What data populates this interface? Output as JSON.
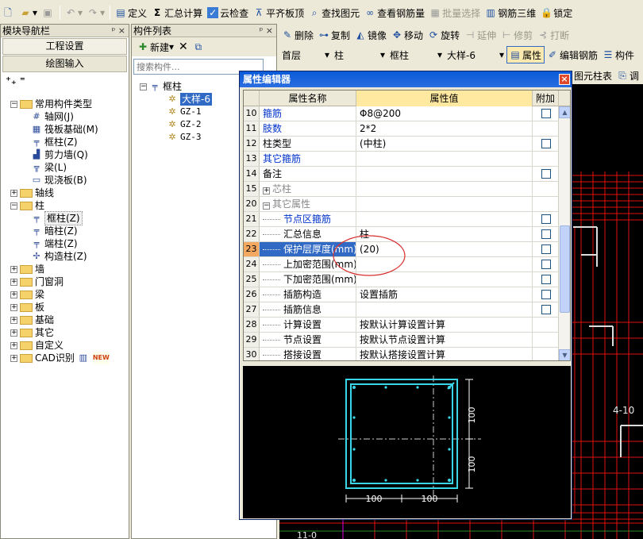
{
  "toolbar1": {
    "items": [
      {
        "label": "定义",
        "icon": "define-icon"
      },
      {
        "label": "汇总计算",
        "icon": "sigma-icon"
      },
      {
        "label": "云检查",
        "icon": "cloud-check-icon"
      },
      {
        "label": "平齐板顶",
        "icon": "align-slab-icon"
      },
      {
        "label": "查找图元",
        "icon": "find-icon"
      },
      {
        "label": "查看钢筋量",
        "icon": "view-rebar-icon"
      },
      {
        "label": "批量选择",
        "icon": "batch-select-icon"
      },
      {
        "label": "钢筋三维",
        "icon": "rebar-3d-icon"
      },
      {
        "label": "锁定",
        "icon": "lock-icon"
      }
    ]
  },
  "toolbar2": {
    "items": [
      {
        "label": "删除",
        "icon": "delete-icon"
      },
      {
        "label": "复制",
        "icon": "copy-icon"
      },
      {
        "label": "镜像",
        "icon": "mirror-icon"
      },
      {
        "label": "移动",
        "icon": "move-icon"
      },
      {
        "label": "旋转",
        "icon": "rotate-icon"
      },
      {
        "label": "延伸",
        "icon": "extend-icon"
      },
      {
        "label": "修剪",
        "icon": "trim-icon"
      },
      {
        "label": "打断",
        "icon": "break-icon"
      }
    ]
  },
  "toolbar3": {
    "floor": "首层",
    "type": "柱",
    "subtype": "框柱",
    "component": "大样-6",
    "properties": "属性",
    "edit_rebar": "编辑钢筋",
    "component_list": "构件",
    "table_tab": "图元柱表",
    "adjust": "调"
  },
  "nav_panel": {
    "title": "模块导航栏",
    "pin": "ᵖ",
    "close": "×",
    "buttons": [
      "工程设置",
      "绘图输入"
    ],
    "tree": [
      {
        "label": "常用构件类型",
        "level": 0,
        "expand": "−",
        "kind": "folder"
      },
      {
        "label": "轴网(J)",
        "level": 1,
        "kind": "grid-icon"
      },
      {
        "label": "筏板基础(M)",
        "level": 1,
        "kind": "raft-icon"
      },
      {
        "label": "框柱(Z)",
        "level": 1,
        "kind": "column-icon"
      },
      {
        "label": "剪力墙(Q)",
        "level": 1,
        "kind": "wall-icon"
      },
      {
        "label": "梁(L)",
        "level": 1,
        "kind": "beam-icon"
      },
      {
        "label": "现浇板(B)",
        "level": 1,
        "kind": "slab-icon"
      },
      {
        "label": "轴线",
        "level": 0,
        "expand": "+",
        "kind": "folder"
      },
      {
        "label": "柱",
        "level": 0,
        "expand": "−",
        "kind": "folder"
      },
      {
        "label": "框柱(Z)",
        "level": 1,
        "kind": "column-icon",
        "selected": true
      },
      {
        "label": "暗柱(Z)",
        "level": 1,
        "kind": "column-icon"
      },
      {
        "label": "端柱(Z)",
        "level": 1,
        "kind": "column-icon"
      },
      {
        "label": "构造柱(Z)",
        "level": 1,
        "kind": "construct-column-icon"
      },
      {
        "label": "墙",
        "level": 0,
        "expand": "+",
        "kind": "folder"
      },
      {
        "label": "门窗洞",
        "level": 0,
        "expand": "+",
        "kind": "folder"
      },
      {
        "label": "梁",
        "level": 0,
        "expand": "+",
        "kind": "folder"
      },
      {
        "label": "板",
        "level": 0,
        "expand": "+",
        "kind": "folder"
      },
      {
        "label": "基础",
        "level": 0,
        "expand": "+",
        "kind": "folder"
      },
      {
        "label": "其它",
        "level": 0,
        "expand": "+",
        "kind": "folder"
      },
      {
        "label": "自定义",
        "level": 0,
        "expand": "+",
        "kind": "folder"
      },
      {
        "label": "CAD识别",
        "level": 0,
        "expand": "+",
        "kind": "folder",
        "badge": "NEW"
      }
    ]
  },
  "comp_panel": {
    "title": "构件列表",
    "new_label": "新建",
    "search_placeholder": "搜索构件...",
    "tree": [
      {
        "label": "框柱",
        "level": 0,
        "expand": "−"
      },
      {
        "label": "大样-6",
        "level": 1,
        "selected": true
      },
      {
        "label": "GZ-1",
        "level": 1
      },
      {
        "label": "GZ-2",
        "level": 1
      },
      {
        "label": "GZ-3",
        "level": 1
      }
    ]
  },
  "dialog": {
    "title": "属性编辑器",
    "close": "×",
    "headers": [
      "属性名称",
      "属性值",
      "附加"
    ],
    "rows": [
      {
        "num": "10",
        "name": "箍筋",
        "value": "Φ8@200",
        "checkbox": true,
        "style": "blue"
      },
      {
        "num": "11",
        "name": "肢数",
        "value": "2*2",
        "checkbox": false,
        "style": "blue"
      },
      {
        "num": "12",
        "name": "柱类型",
        "value": "(中柱)",
        "checkbox": true,
        "style": ""
      },
      {
        "num": "13",
        "name": "其它箍筋",
        "value": "",
        "checkbox": false,
        "style": "blue"
      },
      {
        "num": "14",
        "name": "备注",
        "value": "",
        "checkbox": true,
        "style": ""
      },
      {
        "num": "15",
        "name": "芯柱",
        "value": "",
        "checkbox": false,
        "style": "gray",
        "expand": "+"
      },
      {
        "num": "20",
        "name": "其它属性",
        "value": "",
        "checkbox": false,
        "style": "gray",
        "expand": "−"
      },
      {
        "num": "21",
        "name": "节点区箍筋",
        "value": "",
        "checkbox": true,
        "style": "blue",
        "indent": true
      },
      {
        "num": "22",
        "name": "汇总信息",
        "value": "柱",
        "checkbox": true,
        "style": "",
        "indent": true
      },
      {
        "num": "23",
        "name": "保护层厚度(mm)",
        "value": "(20)",
        "checkbox": true,
        "style": "",
        "indent": true,
        "selected": true
      },
      {
        "num": "24",
        "name": "上加密范围(mm)",
        "value": "",
        "checkbox": true,
        "style": "",
        "indent": true
      },
      {
        "num": "25",
        "name": "下加密范围(mm)",
        "value": "",
        "checkbox": true,
        "style": "",
        "indent": true
      },
      {
        "num": "26",
        "name": "插筋构造",
        "value": "设置插筋",
        "checkbox": true,
        "style": "",
        "indent": true
      },
      {
        "num": "27",
        "name": "插筋信息",
        "value": "",
        "checkbox": true,
        "style": "",
        "indent": true
      },
      {
        "num": "28",
        "name": "计算设置",
        "value": "按默认计算设置计算",
        "checkbox": false,
        "style": "",
        "indent": true
      },
      {
        "num": "29",
        "name": "节点设置",
        "value": "按默认节点设置计算",
        "checkbox": false,
        "style": "",
        "indent": true
      },
      {
        "num": "30",
        "name": "搭接设置",
        "value": "按默认搭接设置计算",
        "checkbox": false,
        "style": "",
        "indent": true
      }
    ],
    "preview": {
      "dim_right_top": "100",
      "dim_right_bottom": "100",
      "dim_bottom_left": "100",
      "dim_bottom_right": "100"
    }
  },
  "cad": {
    "label_right": "4-10",
    "label_bottom": "11-0"
  },
  "colors": {
    "cad_bg": "#000000",
    "cad_red": "#e01010",
    "section_cyan": "#3ad6e8",
    "selection": "#316ac5",
    "annotation_red": "#d83030"
  }
}
